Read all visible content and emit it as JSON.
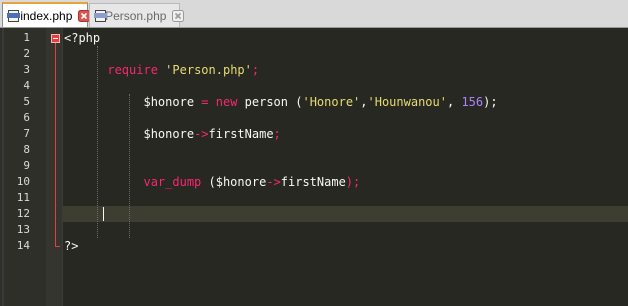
{
  "tabs": [
    {
      "label": "index.php",
      "active": true
    },
    {
      "label": "Person.php",
      "active": false
    }
  ],
  "colors": {
    "editor_bg": "#272822",
    "keyword": "#f92672",
    "string": "#e6db74",
    "number": "#ae81ff",
    "text": "#f8f8f2",
    "fold_marker": "#e04040",
    "active_tab_accent": "#e8a33a"
  },
  "editor": {
    "current_line": 12,
    "lines": [
      {
        "n": "1",
        "tokens": [
          {
            "t": "<?php",
            "c": "plain"
          }
        ]
      },
      {
        "n": "2",
        "tokens": []
      },
      {
        "n": "3",
        "tokens": [
          {
            "t": "      ",
            "c": "plain"
          },
          {
            "t": "require",
            "c": "kw"
          },
          {
            "t": " ",
            "c": "plain"
          },
          {
            "t": "'Person.php'",
            "c": "str"
          },
          {
            "t": ";",
            "c": "kw"
          }
        ]
      },
      {
        "n": "4",
        "tokens": []
      },
      {
        "n": "5",
        "tokens": [
          {
            "t": "           ",
            "c": "plain"
          },
          {
            "t": "$honore",
            "c": "plain"
          },
          {
            "t": " = ",
            "c": "kw"
          },
          {
            "t": "new",
            "c": "kw"
          },
          {
            "t": " person (",
            "c": "plain"
          },
          {
            "t": "'Honore'",
            "c": "str"
          },
          {
            "t": ",",
            "c": "plain"
          },
          {
            "t": "'Hounwanou'",
            "c": "str"
          },
          {
            "t": ", ",
            "c": "plain"
          },
          {
            "t": "156",
            "c": "num"
          },
          {
            "t": ");",
            "c": "plain"
          }
        ]
      },
      {
        "n": "6",
        "tokens": []
      },
      {
        "n": "7",
        "tokens": [
          {
            "t": "           ",
            "c": "plain"
          },
          {
            "t": "$honore",
            "c": "plain"
          },
          {
            "t": "->",
            "c": "kw"
          },
          {
            "t": "firstName",
            "c": "plain"
          },
          {
            "t": ";",
            "c": "kw"
          }
        ]
      },
      {
        "n": "8",
        "tokens": []
      },
      {
        "n": "9",
        "tokens": []
      },
      {
        "n": "10",
        "tokens": [
          {
            "t": "           ",
            "c": "plain"
          },
          {
            "t": "var_dump",
            "c": "kw"
          },
          {
            "t": " (",
            "c": "plain"
          },
          {
            "t": "$honore",
            "c": "plain"
          },
          {
            "t": "->",
            "c": "kw"
          },
          {
            "t": "firstName",
            "c": "plain"
          },
          {
            "t": ");",
            "c": "kw"
          }
        ]
      },
      {
        "n": "11",
        "tokens": []
      },
      {
        "n": "12",
        "tokens": []
      },
      {
        "n": "13",
        "tokens": []
      },
      {
        "n": "14",
        "tokens": [
          {
            "t": "?>",
            "c": "plain"
          }
        ]
      }
    ]
  }
}
